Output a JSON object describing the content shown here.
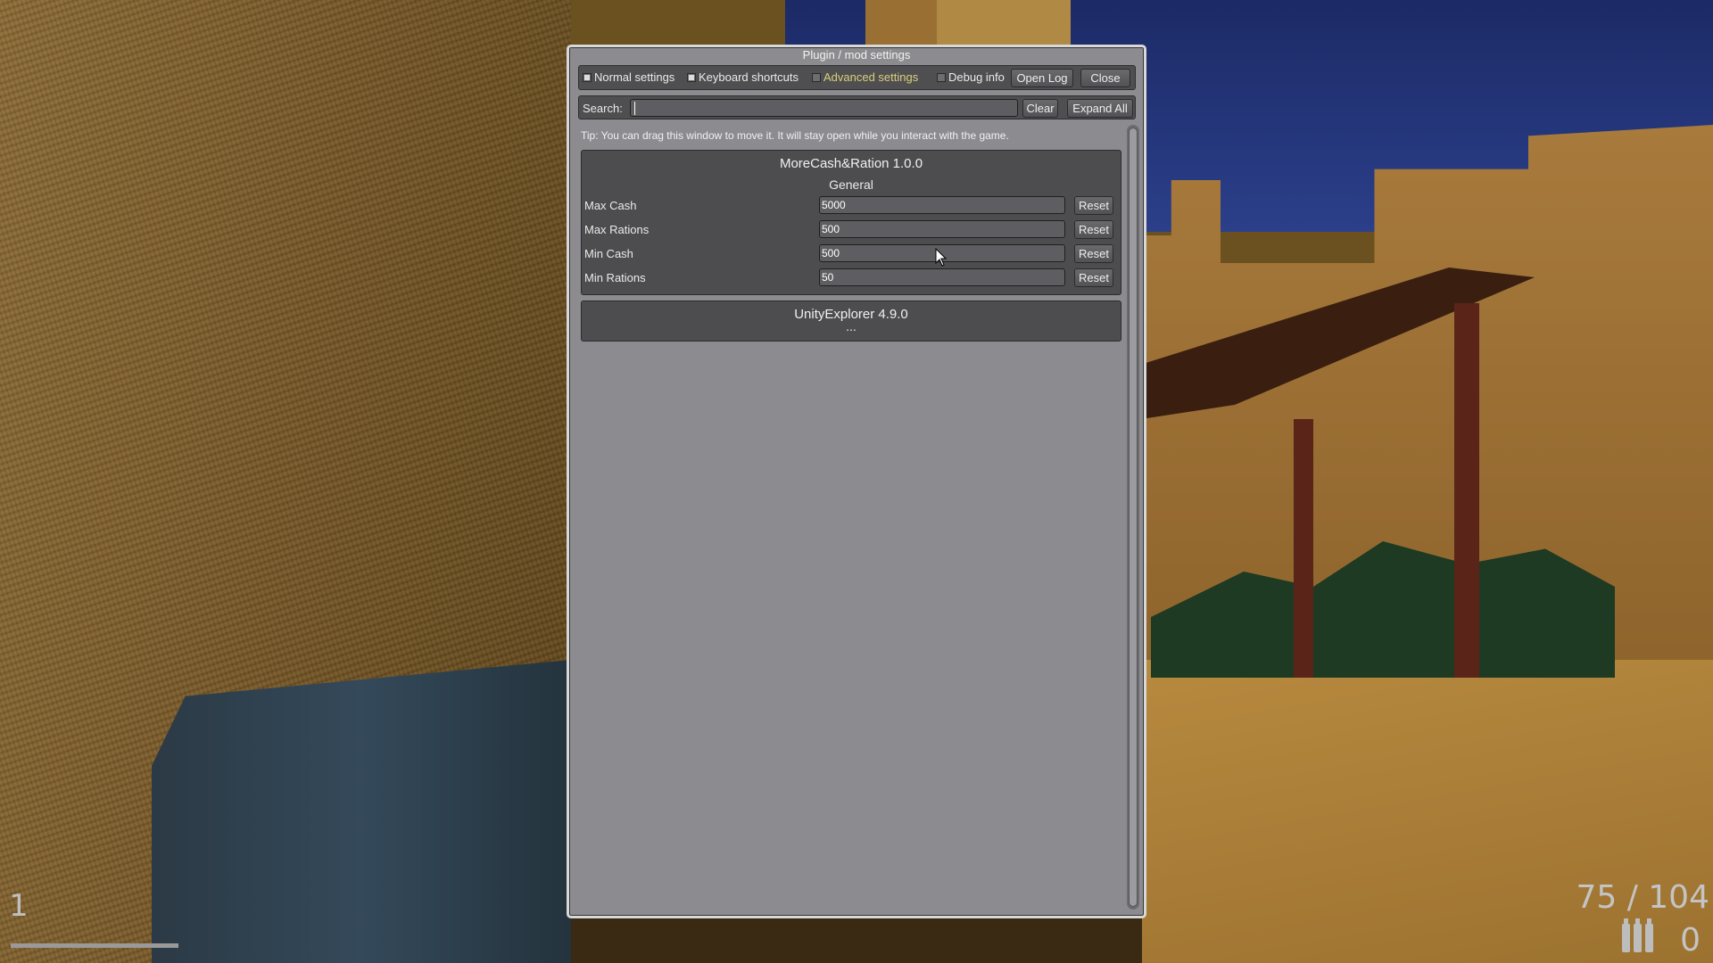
{
  "window": {
    "title": "Plugin / mod settings",
    "toolbar": {
      "normal_settings": "Normal settings",
      "keyboard_shortcuts": "Keyboard shortcuts",
      "advanced_settings": "Advanced settings",
      "debug_info": "Debug info",
      "open_log": "Open Log",
      "close": "Close"
    },
    "search": {
      "label": "Search:",
      "value": "",
      "clear": "Clear",
      "expand_all": "Expand All"
    },
    "tip": "Tip: You can drag this window to move it. It will stay open while you interact with the game.",
    "plugins": [
      {
        "name": "MoreCash&Ration 1.0.0",
        "section": "General",
        "settings": [
          {
            "label": "Max Cash",
            "value": "5000",
            "reset": "Reset"
          },
          {
            "label": "Max Rations",
            "value": "500",
            "reset": "Reset"
          },
          {
            "label": "Min Cash",
            "value": "500",
            "reset": "Reset"
          },
          {
            "label": "Min Rations",
            "value": "50",
            "reset": "Reset"
          }
        ]
      },
      {
        "name": "UnityExplorer 4.9.0",
        "collapsed_indicator": "..."
      }
    ]
  },
  "hud": {
    "slot": "1",
    "ammo": "75 / 104",
    "reserve": "0"
  },
  "colors": {
    "advanced_text": "#d8cf7a",
    "window_bg": "#8c8c90",
    "panel_bg": "#4d4d50"
  }
}
